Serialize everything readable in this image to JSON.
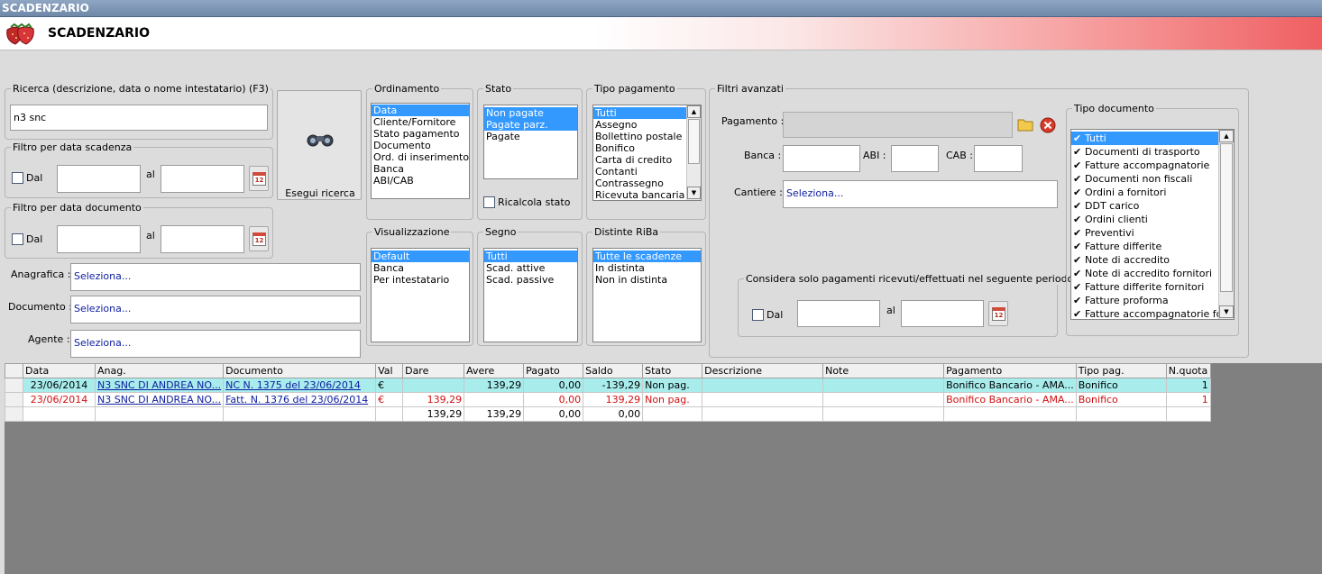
{
  "window": {
    "title": "SCADENZARIO"
  },
  "header": {
    "title": "SCADENZARIO"
  },
  "search": {
    "group_label": "Ricerca (descrizione, data o nome intestatario) (F3)",
    "value": "n3 snc",
    "button_label": "Esegui ricerca"
  },
  "filter_scadenza": {
    "group_label": "Filtro per data scadenza",
    "dal_label": "Dal",
    "al_label": "al"
  },
  "filter_documento": {
    "group_label": "Filtro per data documento",
    "dal_label": "Dal",
    "al_label": "al"
  },
  "lookups": [
    {
      "label": "Anagrafica :",
      "value": "Seleziona..."
    },
    {
      "label": "Documento :",
      "value": "Seleziona..."
    },
    {
      "label": "Agente :",
      "value": "Seleziona..."
    }
  ],
  "ordinamento": {
    "label": "Ordinamento",
    "items": [
      "Data",
      "Cliente/Fornitore",
      "Stato pagamento",
      "Documento",
      "Ord. di inserimento",
      "Banca",
      "ABI/CAB"
    ],
    "selected": [
      0
    ]
  },
  "stato": {
    "label": "Stato",
    "items": [
      "Non pagate",
      "Pagate parz.",
      "Pagate"
    ],
    "selected": [
      0,
      1
    ],
    "ricalcola_label": "Ricalcola stato"
  },
  "tipo_pagamento": {
    "label": "Tipo pagamento",
    "items": [
      "Tutti",
      "Assegno",
      "Bollettino postale",
      "Bonifico",
      "Carta di credito",
      "Contanti",
      "Contrassegno",
      "Ricevuta bancaria"
    ],
    "selected": [
      0
    ]
  },
  "visualizzazione": {
    "label": "Visualizzazione",
    "items": [
      "Default",
      "Banca",
      "Per intestatario"
    ],
    "selected": [
      0
    ]
  },
  "segno": {
    "label": "Segno",
    "items": [
      "Tutti",
      "Scad. attive",
      "Scad. passive"
    ],
    "selected": [
      0
    ]
  },
  "distinte": {
    "label": "Distinte RiBa",
    "items": [
      "Tutte le scadenze",
      "In distinta",
      "Non in distinta"
    ],
    "selected": [
      0
    ]
  },
  "filtri_avanzati": {
    "label": "Filtri avanzati",
    "pagamento_label": "Pagamento :",
    "banca_label": "Banca :",
    "abi_label": "ABI :",
    "cab_label": "CAB :",
    "cantiere_label": "Cantiere :",
    "cantiere_value": "Seleziona...",
    "periodo": {
      "label": "Considera solo pagamenti ricevuti/effettuati nel seguente periodo",
      "dal_label": "Dal",
      "al_label": "al"
    }
  },
  "tipo_documento": {
    "label": "Tipo documento",
    "items": [
      "Tutti",
      "Documenti di trasporto",
      "Fatture accompagnatorie",
      "Documenti non fiscali",
      "Ordini a fornitori",
      "DDT carico",
      "Ordini clienti",
      "Preventivi",
      "Fatture differite",
      "Note di accredito",
      "Note di accredito fornitori",
      "Fatture differite fornitori",
      "Fatture proforma",
      "Fatture accompagnatorie forni"
    ],
    "checked": [
      true,
      true,
      true,
      true,
      true,
      true,
      true,
      true,
      true,
      true,
      true,
      true,
      true,
      true
    ],
    "selected": [
      0
    ]
  },
  "grid": {
    "columns": [
      "Data",
      "Anag.",
      "Documento",
      "Val",
      "Dare",
      "Avere",
      "Pagato",
      "Saldo",
      "Stato",
      "Descrizione",
      "Note",
      "Pagamento",
      "Tipo pag.",
      "N.quota"
    ],
    "rows": [
      {
        "style": "cyan",
        "cells": [
          "23/06/2014",
          "N3 SNC DI ANDREA NO...",
          "NC N. 1375 del 23/06/2014",
          "€",
          "",
          "139,29",
          "0,00",
          "-139,29",
          "Non pag.",
          "",
          "",
          "Bonifico Bancario - AMA...",
          "Bonifico",
          "1"
        ]
      },
      {
        "style": "red",
        "cells": [
          "23/06/2014",
          "N3 SNC DI ANDREA NO...",
          "Fatt. N. 1376 del 23/06/2014",
          "€",
          "139,29",
          "",
          "0,00",
          "139,29",
          "Non pag.",
          "",
          "",
          "Bonifico Bancario - AMA...",
          "Bonifico",
          "1"
        ]
      },
      {
        "style": "total",
        "cells": [
          "",
          "",
          "",
          "",
          "139,29",
          "139,29",
          "0,00",
          "0,00",
          "",
          "",
          "",
          "",
          "",
          ""
        ]
      }
    ]
  }
}
